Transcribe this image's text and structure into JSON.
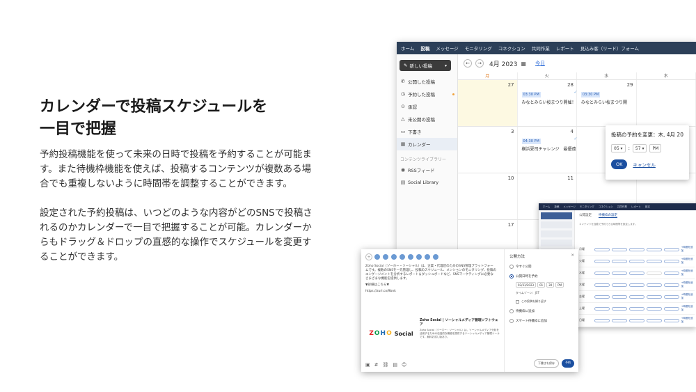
{
  "headline": {
    "line1": "カレンダーで投稿スケジュールを",
    "line2": "一目で把握"
  },
  "paragraph1": {
    "line1": "予約投稿機能を使って未来の日時で投稿を予約することが可能ま",
    "line2": "す。また待機枠機能を使えば、投稿するコンテンツが複数ある場",
    "line3": "合でも重複しないように時間帯を調整することができます。"
  },
  "paragraph2": {
    "line1": "設定された予約投稿は、いつどのような内容がどのSNSで投稿さ",
    "line2": "れるのかカレンダーで一目で把握することが可能。カレンダーか",
    "line3": "らもドラッグ＆ドロップの直感的な操作でスケジュールを変更す",
    "line4": "ることができます。"
  },
  "app": {
    "nav": [
      "ホーム",
      "投稿",
      "メッセージ",
      "モニタリング",
      "コネクション",
      "共同作業",
      "レポート",
      "見込み客（リード）フォーム"
    ],
    "new_post": "新しい投稿",
    "sidebar": {
      "published": "公開した投稿",
      "scheduled": "予約した投稿",
      "approval": "承認",
      "unpublished": "未公開の投稿",
      "drafts": "下書き",
      "calendar": "カレンダー",
      "library_section": "コンテンツライブラリー",
      "rss": "RSSフィード",
      "social_library": "Social Library"
    },
    "calendar": {
      "month": "4月 2023",
      "today": "今日",
      "day_headers": [
        "月",
        "火",
        "水",
        "木"
      ],
      "week1": {
        "d1": "27",
        "d2": "28",
        "d3": "29"
      },
      "week2": {
        "d1": "3",
        "d2": "4"
      },
      "week3": {
        "d1": "10",
        "d2": "11"
      },
      "week4": {
        "d1": "17"
      },
      "events": {
        "e1_time": "03:30 PM",
        "e1_title": "みなとみらい桜まつり開催！",
        "e2_time": "03:30 PM",
        "e2_title": "みなとみらい桜まつり開",
        "e3_time": "04:30 PM",
        "e3_title": "横浜夏司チャレンジ　最優遠"
      }
    },
    "popup": {
      "title": "投稿の予約を変更：木, 4月 20",
      "hour": "05",
      "minute": "57",
      "ampm": "PM",
      "ok": "OK",
      "cancel": "キャンセル"
    }
  },
  "compose": {
    "text_p1": "Zoho Social（ゾーホー・ソーシャル）は、企業・代理店のためのSNS管理プラットフォームです。複数のSNSを一元管理し、投稿のスケジュール、メンションのモニタリング、投稿のエンゲージメントを分析するレポート＆ダッシュボードなど、SNSマーケティングに必要なさまざまな機能を提供します。",
    "text_p2": "▼詳細はこちら▼",
    "text_p3": "https://zurl.co/9bnk",
    "preview_title": "Zoho Social | ソーシャルメディア管理ソフトウェア",
    "preview_body": "Zoho Social（ゾーホー・ソーシャル）は、ソーシャルメディア分析を活用するための包括的な機能を提供するソーシャルメディア管理ツールです。無料お試し版あり。",
    "logo_word": "Social",
    "right_title": "公開方法",
    "opt_now": "今すぐ公開",
    "opt_schedule": "公開日時を予約",
    "date": "03/31/2023",
    "hour": "01",
    "minute": "30",
    "ampm": "PM",
    "timezone": "タイムゾーン：JST",
    "chk_repeat": "この投稿を繰り返す",
    "opt_queue": "待機枠に追加",
    "opt_smart": "スマート待機枠に追加",
    "draft_btn": "下書きを保存",
    "schedule_btn": "予約"
  },
  "win2": {
    "nav": [
      "ホーム",
      "投稿",
      "メッセージ",
      "モニタリング",
      "コネクション",
      "共同作業",
      "レポート",
      "設定"
    ],
    "tab1": "公開設定",
    "tab2": "待機枠の設定",
    "desc": "コンテンツを自動で予約できる時間帯を設定します。",
    "days": [
      "月曜",
      "火曜",
      "水曜",
      "木曜",
      "金曜",
      "土曜",
      "日曜"
    ],
    "add_label": "+時間を追加"
  }
}
